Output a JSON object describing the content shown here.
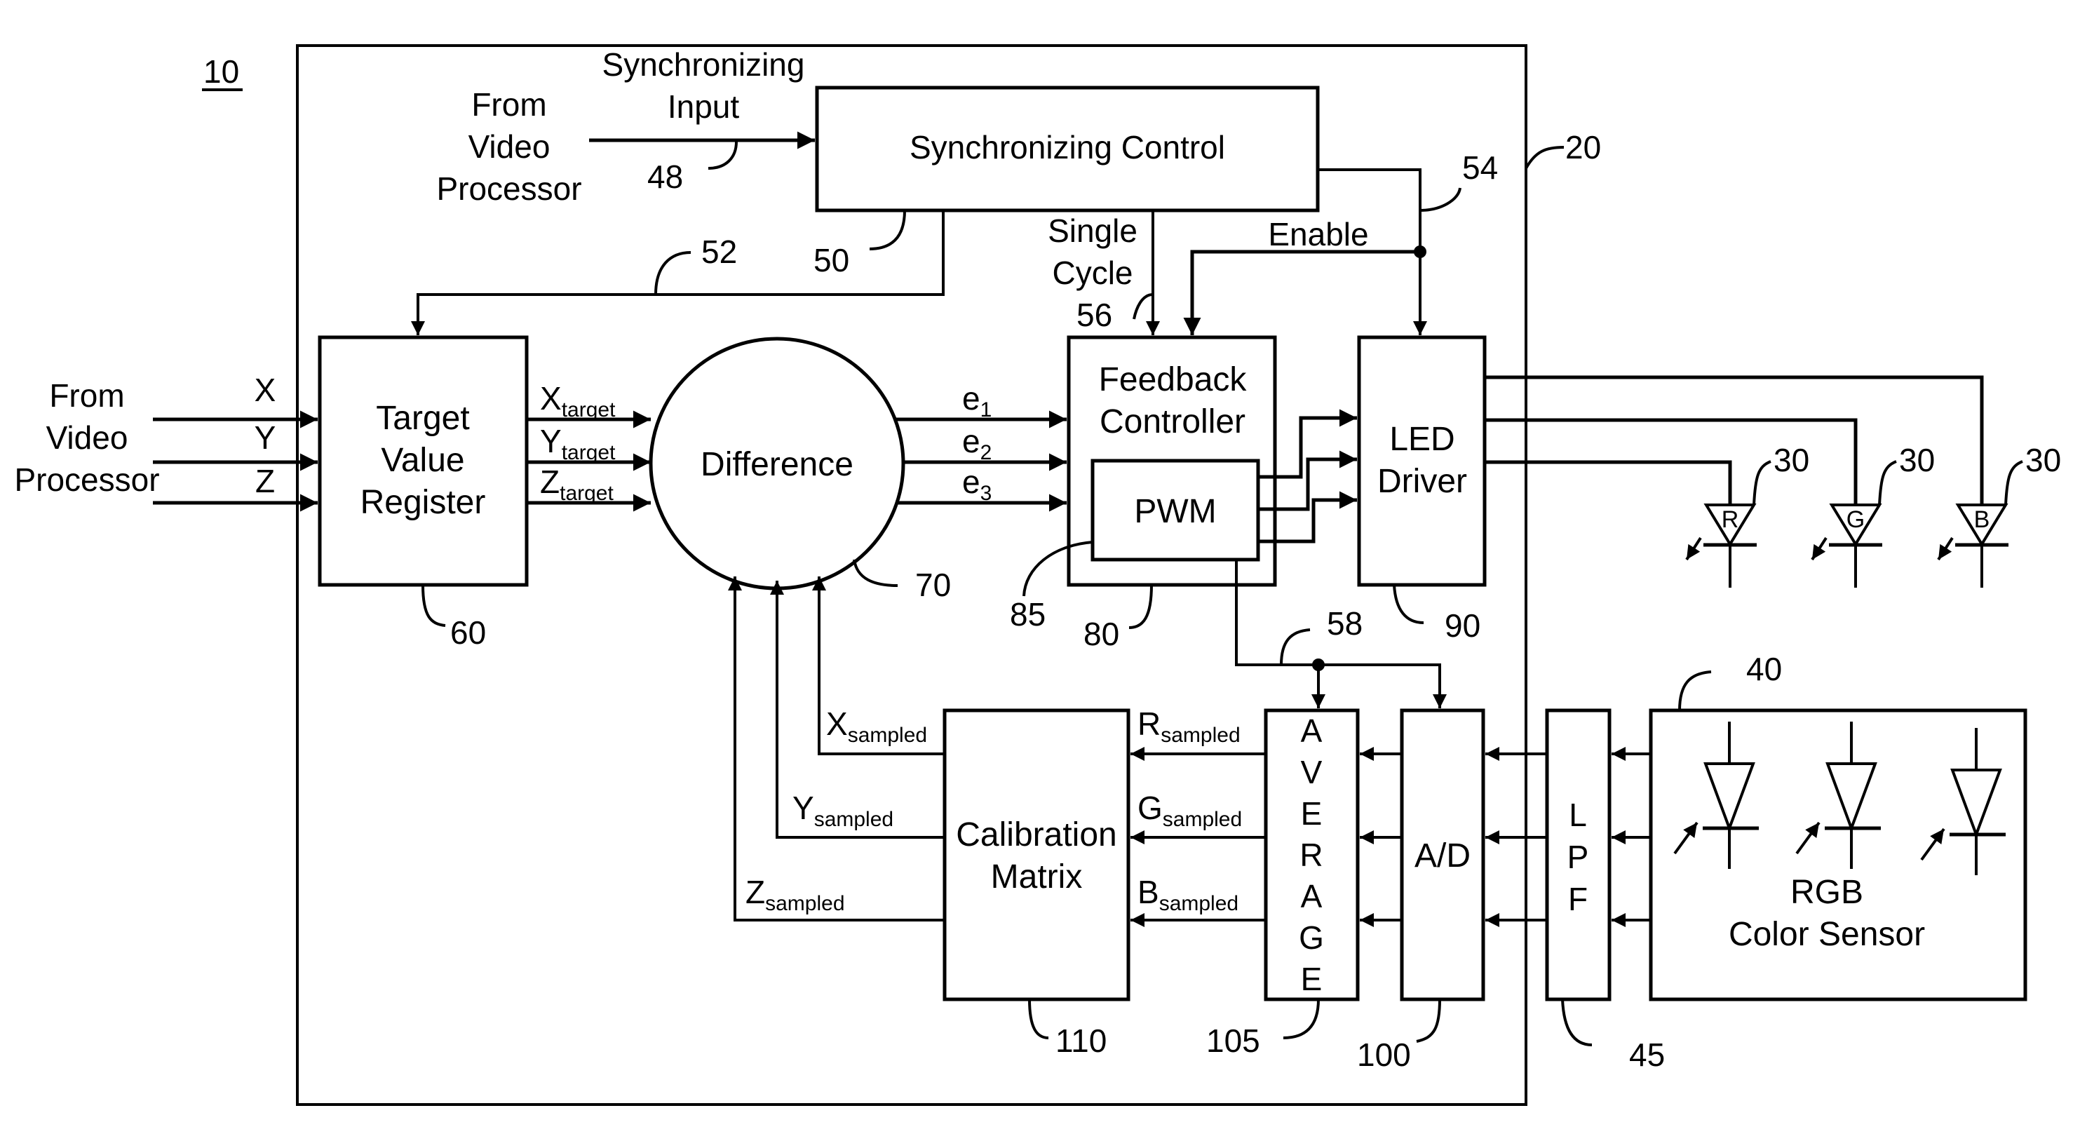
{
  "figure": {
    "system_ref": "10",
    "controller_ref": "20"
  },
  "inputs": {
    "video_source_left": [
      "From",
      "Video",
      "Processor"
    ],
    "video_source_top": [
      "From",
      "Video",
      "Processor"
    ],
    "sync_input_label": [
      "Synchronizing",
      "Input"
    ],
    "sync_input_ref": "48",
    "xyz_labels": [
      "X",
      "Y",
      "Z"
    ]
  },
  "blocks": {
    "sync_control": {
      "label": "Synchronizing Control",
      "ref": "50"
    },
    "target_register": {
      "label": [
        "Target",
        "Value",
        "Register"
      ],
      "ref": "60"
    },
    "difference": {
      "label": "Difference",
      "ref": "70"
    },
    "feedback_controller": {
      "label": [
        "Feedback",
        "Controller"
      ],
      "ref": "80"
    },
    "pwm": {
      "label": "PWM",
      "ref": "85"
    },
    "led_driver": {
      "label": [
        "LED",
        "Driver"
      ],
      "ref": "90"
    },
    "calibration_matrix": {
      "label": [
        "Calibration",
        "Matrix"
      ],
      "ref": "110"
    },
    "average": {
      "label": [
        "A",
        "V",
        "E",
        "R",
        "A",
        "G",
        "E"
      ],
      "ref": "105"
    },
    "ad_converter": {
      "label": "A/D",
      "ref": "100"
    },
    "lpf": {
      "label": [
        "L",
        "P",
        "F"
      ],
      "ref": "45"
    },
    "rgb_sensor": {
      "label": [
        "RGB",
        "Color Sensor"
      ],
      "ref": "40"
    }
  },
  "signals": {
    "target_outputs": [
      {
        "main": "X",
        "sub": "target"
      },
      {
        "main": "Y",
        "sub": "target"
      },
      {
        "main": "Z",
        "sub": "target"
      }
    ],
    "errors": [
      {
        "main": "e",
        "sub": "1"
      },
      {
        "main": "e",
        "sub": "2"
      },
      {
        "main": "e",
        "sub": "3"
      }
    ],
    "sampled_xyz": [
      {
        "main": "X",
        "sub": "sampled"
      },
      {
        "main": "Y",
        "sub": "sampled"
      },
      {
        "main": "Z",
        "sub": "sampled"
      }
    ],
    "sampled_rgb": [
      {
        "main": "R",
        "sub": "sampled"
      },
      {
        "main": "G",
        "sub": "sampled"
      },
      {
        "main": "B",
        "sub": "sampled"
      }
    ],
    "single_cycle": [
      "Single",
      "Cycle"
    ],
    "single_cycle_ref": "56",
    "enable": "Enable",
    "enable_ref": "54",
    "sync_to_register_ref": "52",
    "sample_trigger_ref": "58"
  },
  "leds": [
    {
      "label": "R",
      "ref": "30"
    },
    {
      "label": "G",
      "ref": "30"
    },
    {
      "label": "B",
      "ref": "30"
    }
  ]
}
